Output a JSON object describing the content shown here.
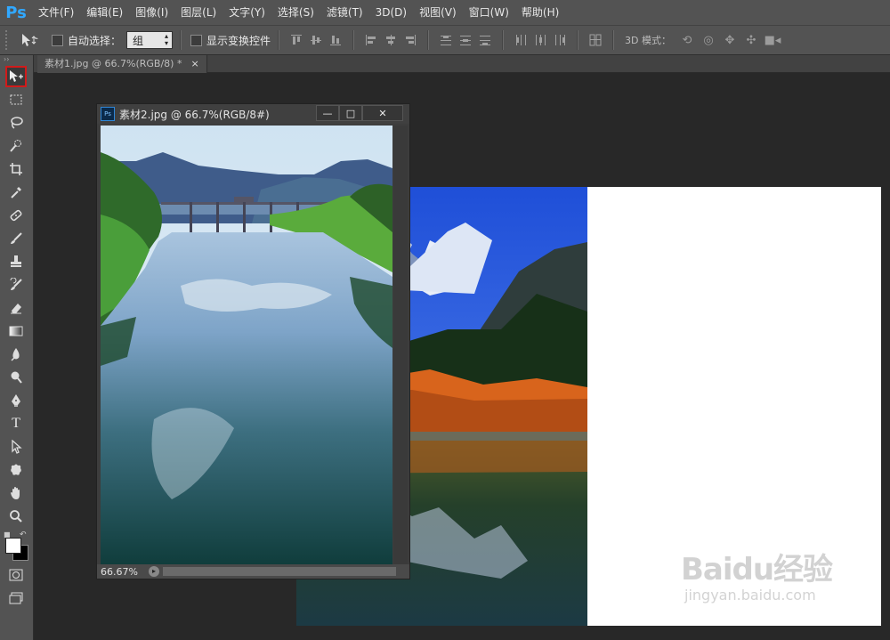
{
  "app": {
    "logo": "Ps"
  },
  "menu": [
    "文件(F)",
    "编辑(E)",
    "图像(I)",
    "图层(L)",
    "文字(Y)",
    "选择(S)",
    "滤镜(T)",
    "3D(D)",
    "视图(V)",
    "窗口(W)",
    "帮助(H)"
  ],
  "options": {
    "tool_icon": "move-icon",
    "auto_select_label": "自动选择：",
    "auto_select_checked": false,
    "select_value": "组",
    "transform_label": "显示变换控件",
    "transform_checked": false,
    "mode_label": "3D 模式："
  },
  "tools": [
    "move-tool",
    "marquee-tool",
    "lasso-tool",
    "quick-select-tool",
    "crop-tool",
    "eyedropper-tool",
    "healing-brush-tool",
    "brush-tool",
    "clone-stamp-tool",
    "history-brush-tool",
    "eraser-tool",
    "gradient-tool",
    "blur-tool",
    "dodge-tool",
    "pen-tool",
    "type-tool",
    "path-select-tool",
    "shape-tool",
    "hand-tool",
    "zoom-tool"
  ],
  "swatches": {
    "foreground": "#ffffff",
    "background": "#000000"
  },
  "document_tab": {
    "title": "素材1.jpg @ 66.7%(RGB/8) *",
    "close": "×"
  },
  "floating_window": {
    "title": "素材2.jpg @ 66.7%(RGB/8#)",
    "zoom": "66.67%",
    "minimize": "—",
    "maximize": "□",
    "close": "✕"
  },
  "watermark": {
    "main": "Baidu经验",
    "sub": "jingyan.baidu.com"
  },
  "colors": {
    "panel": "#535353",
    "workspace": "#282828",
    "active_highlight": "#d01b1b",
    "ps_blue": "#31a8ff"
  }
}
